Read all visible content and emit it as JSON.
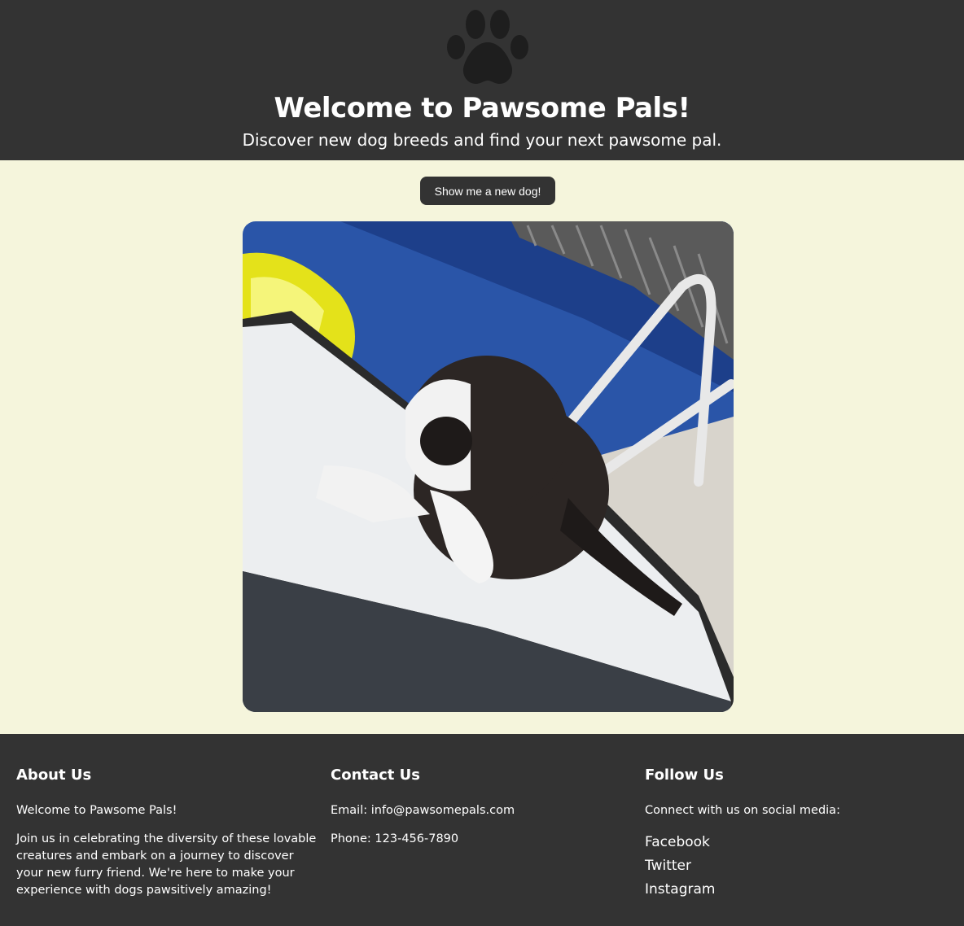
{
  "header": {
    "title": "Welcome to Pawsome Pals!",
    "subtitle": "Discover new dog breeds and find your next pawsome pal.",
    "logo_icon": "paw-icon"
  },
  "main": {
    "button_label": "Show me a new dog!",
    "image_alt": "dog photo"
  },
  "footer": {
    "about": {
      "heading": "About Us",
      "p1": "Welcome to Pawsome Pals!",
      "p2": "Join us in celebrating the diversity of these lovable creatures and embark on a journey to discover your new furry friend. We're here to make your experience with dogs pawsitively amazing!"
    },
    "contact": {
      "heading": "Contact Us",
      "email": "Email: info@pawsomepals.com",
      "phone": "Phone: 123-456-7890"
    },
    "follow": {
      "heading": "Follow Us",
      "intro": "Connect with us on social media:",
      "links": [
        "Facebook",
        "Twitter",
        "Instagram"
      ]
    }
  },
  "colors": {
    "dark": "#333333",
    "page_bg": "#f5f5dc"
  }
}
